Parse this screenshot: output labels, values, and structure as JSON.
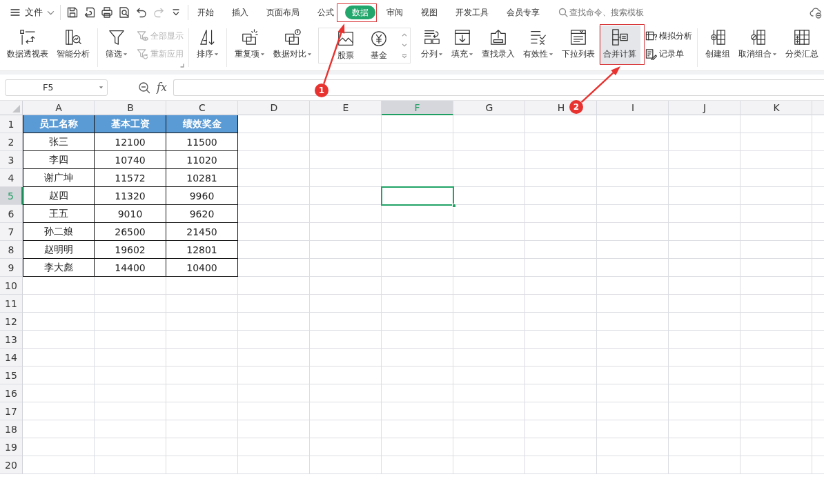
{
  "menu_bar": {
    "file_menu": {
      "label": "文件"
    },
    "quick_access": [
      {
        "disabled": false
      },
      {
        "disabled": false
      },
      {
        "disabled": false
      },
      {
        "disabled": false
      },
      {
        "disabled": false
      },
      {
        "disabled": true
      },
      {
        "disabled": false
      }
    ],
    "tabs": [
      {
        "label": "开始",
        "selected": false
      },
      {
        "label": "插入",
        "selected": false
      },
      {
        "label": "页面布局",
        "selected": false
      },
      {
        "label": "公式",
        "selected": false
      },
      {
        "label": "数据",
        "selected": true
      },
      {
        "label": "审阅",
        "selected": false
      },
      {
        "label": "视图",
        "selected": false
      },
      {
        "label": "开发工具",
        "selected": false
      },
      {
        "label": "会员专享",
        "selected": false
      }
    ],
    "search": {
      "placeholder": "查找命令、搜索模板"
    }
  },
  "ribbon": {
    "groups": [
      {
        "kind": "buttons",
        "items": [
          {
            "kind": "large",
            "label": "数据透视表",
            "dropdown": false,
            "disabled": false,
            "hovered": false
          },
          {
            "kind": "large",
            "label": "智能分析",
            "dropdown": false,
            "disabled": false,
            "hovered": false
          }
        ]
      },
      {
        "kind": "buttons",
        "items": [
          {
            "kind": "large",
            "label": "筛选",
            "dropdown": true,
            "disabled": false,
            "hovered": false
          },
          {
            "kind": "small",
            "label": "全部显示",
            "dropdown": false,
            "disabled": true,
            "hovered": false
          },
          {
            "kind": "small",
            "label": "重新应用",
            "dropdown": false,
            "disabled": true,
            "hovered": false
          }
        ]
      },
      {
        "kind": "buttons",
        "items": [
          {
            "kind": "large",
            "label": "排序",
            "dropdown": true,
            "disabled": false,
            "hovered": false
          }
        ]
      },
      {
        "kind": "buttons",
        "items": [
          {
            "kind": "large",
            "label": "重复项",
            "dropdown": true,
            "disabled": false,
            "hovered": false
          },
          {
            "kind": "large",
            "label": "数据对比",
            "dropdown": true,
            "disabled": false,
            "hovered": false
          }
        ]
      },
      {
        "kind": "gallery",
        "items": [
          {
            "kind": "large",
            "label": "股票",
            "dropdown": false,
            "disabled": false,
            "hovered": false
          },
          {
            "kind": "large",
            "label": "基金",
            "dropdown": false,
            "disabled": false,
            "hovered": false
          }
        ]
      },
      {
        "kind": "buttons",
        "items": [
          {
            "kind": "large",
            "label": "分列",
            "dropdown": true,
            "disabled": false,
            "hovered": false
          },
          {
            "kind": "large",
            "label": "填充",
            "dropdown": true,
            "disabled": false,
            "hovered": false
          },
          {
            "kind": "large",
            "label": "查找录入",
            "dropdown": false,
            "disabled": false,
            "hovered": false
          },
          {
            "kind": "large",
            "label": "有效性",
            "dropdown": true,
            "disabled": false,
            "hovered": false
          },
          {
            "kind": "large",
            "label": "下拉列表",
            "dropdown": false,
            "disabled": false,
            "hovered": false
          },
          {
            "kind": "large",
            "label": "合并计算",
            "dropdown": false,
            "disabled": false,
            "hovered": true
          },
          {
            "kind": "small",
            "label": "模拟分析",
            "dropdown": false,
            "disabled": false,
            "hovered": false
          },
          {
            "kind": "small",
            "label": "记录单",
            "dropdown": false,
            "disabled": false,
            "hovered": false
          }
        ]
      },
      {
        "kind": "buttons",
        "items": [
          {
            "kind": "large",
            "label": "创建组",
            "dropdown": false,
            "disabled": false,
            "hovered": false
          },
          {
            "kind": "large",
            "label": "取消组合",
            "dropdown": true,
            "disabled": false,
            "hovered": false
          },
          {
            "kind": "large",
            "label": "分类汇总",
            "dropdown": false,
            "disabled": false,
            "hovered": false
          }
        ]
      }
    ]
  },
  "formula_bar": {
    "name_box": "F5",
    "function_label": "fx"
  },
  "sheet": {
    "columns": [
      {
        "label": "A",
        "selected": false
      },
      {
        "label": "B",
        "selected": false
      },
      {
        "label": "C",
        "selected": false
      },
      {
        "label": "D",
        "selected": false
      },
      {
        "label": "E",
        "selected": false
      },
      {
        "label": "F",
        "selected": true
      },
      {
        "label": "G",
        "selected": false
      },
      {
        "label": "H",
        "selected": false
      },
      {
        "label": "I",
        "selected": false
      },
      {
        "label": "J",
        "selected": false
      },
      {
        "label": "K",
        "selected": false
      }
    ],
    "rows": [
      {
        "label": "1",
        "selected": false,
        "kind": "header",
        "cells": [
          "员工名称",
          "基本工资",
          "绩效奖金"
        ]
      },
      {
        "label": "2",
        "selected": false,
        "kind": "data",
        "cells": [
          "张三",
          "12100",
          "11500"
        ]
      },
      {
        "label": "3",
        "selected": false,
        "kind": "data",
        "cells": [
          "李四",
          "10740",
          "11020"
        ]
      },
      {
        "label": "4",
        "selected": false,
        "kind": "data",
        "cells": [
          "谢广坤",
          "11572",
          "10281"
        ]
      },
      {
        "label": "5",
        "selected": true,
        "kind": "data",
        "cells": [
          "赵四",
          "11320",
          "9960"
        ]
      },
      {
        "label": "6",
        "selected": false,
        "kind": "data",
        "cells": [
          "王五",
          "9010",
          "9620"
        ]
      },
      {
        "label": "7",
        "selected": false,
        "kind": "data",
        "cells": [
          "孙二娘",
          "26500",
          "21450"
        ]
      },
      {
        "label": "8",
        "selected": false,
        "kind": "data",
        "cells": [
          "赵明明",
          "19602",
          "12801"
        ]
      },
      {
        "label": "9",
        "selected": false,
        "kind": "data",
        "cells": [
          "李大彪",
          "14400",
          "10400"
        ]
      },
      {
        "label": "10",
        "selected": false,
        "kind": "empty"
      },
      {
        "label": "11",
        "selected": false,
        "kind": "empty"
      },
      {
        "label": "12",
        "selected": false,
        "kind": "empty"
      },
      {
        "label": "13",
        "selected": false,
        "kind": "empty"
      },
      {
        "label": "14",
        "selected": false,
        "kind": "empty"
      },
      {
        "label": "15",
        "selected": false,
        "kind": "empty"
      },
      {
        "label": "16",
        "selected": false,
        "kind": "empty"
      },
      {
        "label": "17",
        "selected": false,
        "kind": "empty"
      },
      {
        "label": "18",
        "selected": false,
        "kind": "empty"
      },
      {
        "label": "19",
        "selected": false,
        "kind": "empty"
      },
      {
        "label": "20",
        "selected": false,
        "kind": "empty"
      }
    ]
  },
  "annotations": [
    {
      "label": "1"
    },
    {
      "label": "2"
    }
  ]
}
